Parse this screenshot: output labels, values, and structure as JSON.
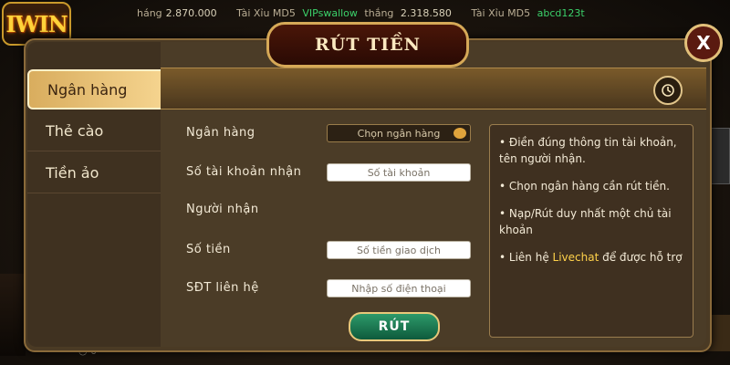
{
  "ticker": {
    "segments": [
      {
        "text": "háng",
        "amount": "2.870.000"
      },
      {
        "text": "Tài Xỉu MD5",
        "user": "VIPswallow",
        "label": "thắng",
        "amount": "2.318.580"
      },
      {
        "text": "Tài Xỉu MD5",
        "user": "abcd123t"
      }
    ]
  },
  "logo": {
    "text": "IWIN"
  },
  "dialog": {
    "title": "RÚT TIỀN",
    "close_label": "X",
    "nav": [
      {
        "label": "Ngân hàng"
      },
      {
        "label": "Thẻ cào"
      },
      {
        "label": "Tiền ảo"
      }
    ],
    "form": {
      "bank_label": "Ngân hàng",
      "bank_placeholder": "Chọn ngân hàng",
      "account_label": "Số tài khoản nhận",
      "account_placeholder": "Số tài khoản",
      "receiver_label": "Người nhận",
      "amount_label": "Số tiền",
      "amount_placeholder": "Số tiền giao dịch",
      "phone_label": "SĐT liên hệ",
      "phone_placeholder": "Nhập số điện thoại",
      "submit_label": "RÚT"
    },
    "info": [
      "• Điền đúng thông tin tài khoản, tên người nhận.",
      "• Chọn ngân hàng cần rút tiền.",
      "• Nạp/Rút duy nhất một chủ tài khoản"
    ],
    "info_livechat": {
      "prefix": "• Liên hệ ",
      "highlight": "Livechat",
      "suffix": " để được hỗ trợ"
    }
  },
  "bottom": {
    "count": "0"
  }
}
